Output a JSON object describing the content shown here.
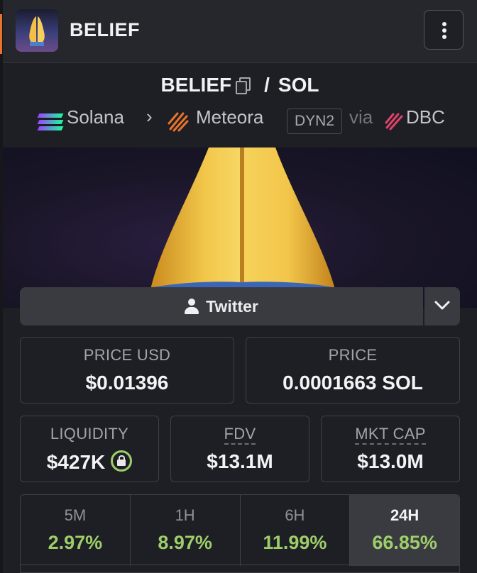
{
  "header": {
    "token_name": "BELIEF",
    "logo_icon": "praying-hands-icon",
    "menu_icon": "vertical-dots-icon"
  },
  "pair": {
    "base": "BELIEF",
    "separator": "/",
    "quote": "SOL"
  },
  "route": {
    "chain": "Solana",
    "dex": "Meteora",
    "pool_type": "DYN2",
    "via_label": "via",
    "launchpad": "DBC"
  },
  "socials": {
    "twitter_label": "Twitter"
  },
  "stats": {
    "price_usd": {
      "label": "PRICE USD",
      "value": "$0.01396"
    },
    "price": {
      "label": "PRICE",
      "value": "0.0001663 SOL"
    },
    "liquidity": {
      "label": "LIQUIDITY",
      "value": "$427K"
    },
    "fdv": {
      "label": "FDV",
      "value": "$13.1M"
    },
    "mkt_cap": {
      "label": "MKT CAP",
      "value": "$13.0M"
    }
  },
  "timeframes": [
    {
      "label": "5M",
      "value": "2.97%"
    },
    {
      "label": "1H",
      "value": "8.97%"
    },
    {
      "label": "6H",
      "value": "11.99%"
    },
    {
      "label": "24H",
      "value": "66.85%",
      "active": true
    }
  ],
  "colors": {
    "accent_orange": "#e8732a",
    "positive_green": "#9ece6a",
    "background": "#1e1f24"
  }
}
